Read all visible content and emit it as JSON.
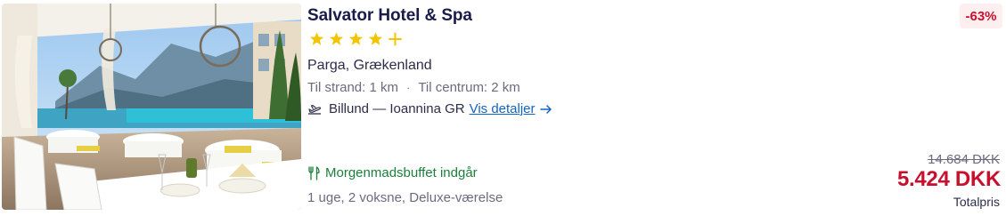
{
  "hotel": {
    "name": "Salvator Hotel & Spa",
    "stars": 4,
    "half_star": true,
    "star_color": "#f2c500",
    "location": "Parga, Grækenland",
    "distance_beach": "Til strand: 1 km",
    "separator": "·",
    "distance_center": "Til centrum: 2 km"
  },
  "flight": {
    "icon": "plane-icon",
    "route": "Billund — Ioannina GR",
    "details_link": "Vis detaljer"
  },
  "features": {
    "breakfast": "Morgenmadsbuffet indgår",
    "breakfast_color": "#1b7f3a"
  },
  "package": "1 uge, 2 voksne, Deluxe-værelse",
  "pricing": {
    "discount": "-63%",
    "old_price": "14.684 DKK",
    "price": "5.424 DKK",
    "total_label": "Totalpris",
    "accent": "#c8102e"
  },
  "photo": {
    "icon": "hotel-photo"
  }
}
